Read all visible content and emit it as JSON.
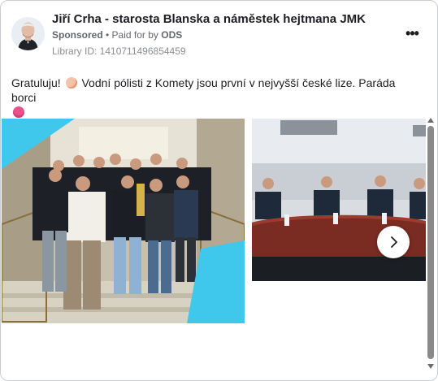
{
  "post": {
    "author": "Jiří Crha - starosta Blanska a náměstek hejtmana JMK",
    "sponsored": "Sponsored",
    "separator": " • ",
    "paid_for_by": "Paid for by ",
    "sponsor": "ODS",
    "library_id": "Library ID: 1410711496854459",
    "text_part1": "Gratuluju!",
    "text_part2": "Vodní pólisti z Komety jsou první v nejvyšší české lize. Paráda borci",
    "emoji_1": "shell-emoji",
    "emoji_2": "heart-eyes-emoji"
  },
  "actions": {
    "more_icon": "•••"
  },
  "carousel": {
    "photos": [
      "team-trophy-photo",
      "team-meeting-photo"
    ],
    "next_icon": "chevron-right-icon"
  },
  "colors": {
    "accent_cyan": "#3fc8ec",
    "text": "#1c1e21",
    "secondary": "#65676b"
  }
}
